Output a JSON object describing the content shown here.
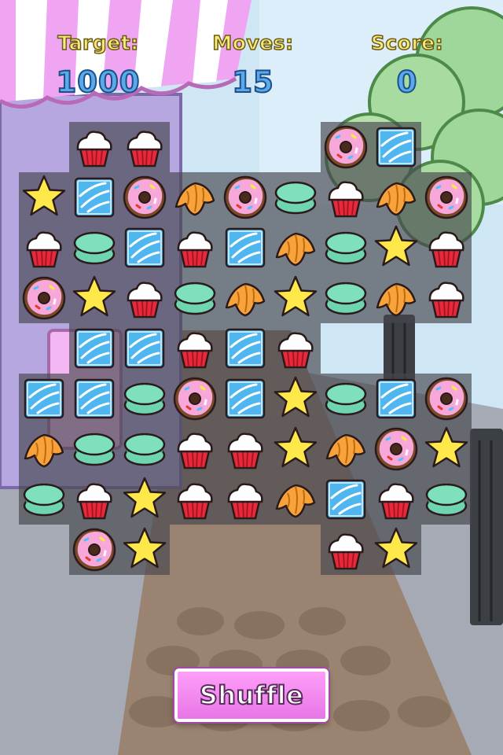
{
  "hud": {
    "target_label": "Target:",
    "target_value": "1000",
    "moves_label": "Moves:",
    "moves_value": "15",
    "score_label": "Score:",
    "score_value": "0"
  },
  "board": {
    "columns": 9,
    "rows": 9,
    "pieces": {
      "C": "cupcake",
      "D": "donut",
      "I": "ice-block",
      "S": "star",
      "M": "macaron",
      "R": "croissant"
    },
    "grid": [
      "-CC---DI-",
      "SIDRDMCRD",
      "CMICIRMSC",
      "DSCMRSMRC",
      "-IICIC---",
      "IIMDISMID",
      "RMMCCSRDS",
      "MCSCCRICM",
      "-DS---CS-"
    ]
  },
  "shuffle_button": {
    "label": "Shuffle"
  },
  "colors": {
    "label_yellow": "#f7e97e",
    "value_blue": "#5aa9ea",
    "button_pink": "#f08cf0",
    "board_panel": "#46464e"
  }
}
